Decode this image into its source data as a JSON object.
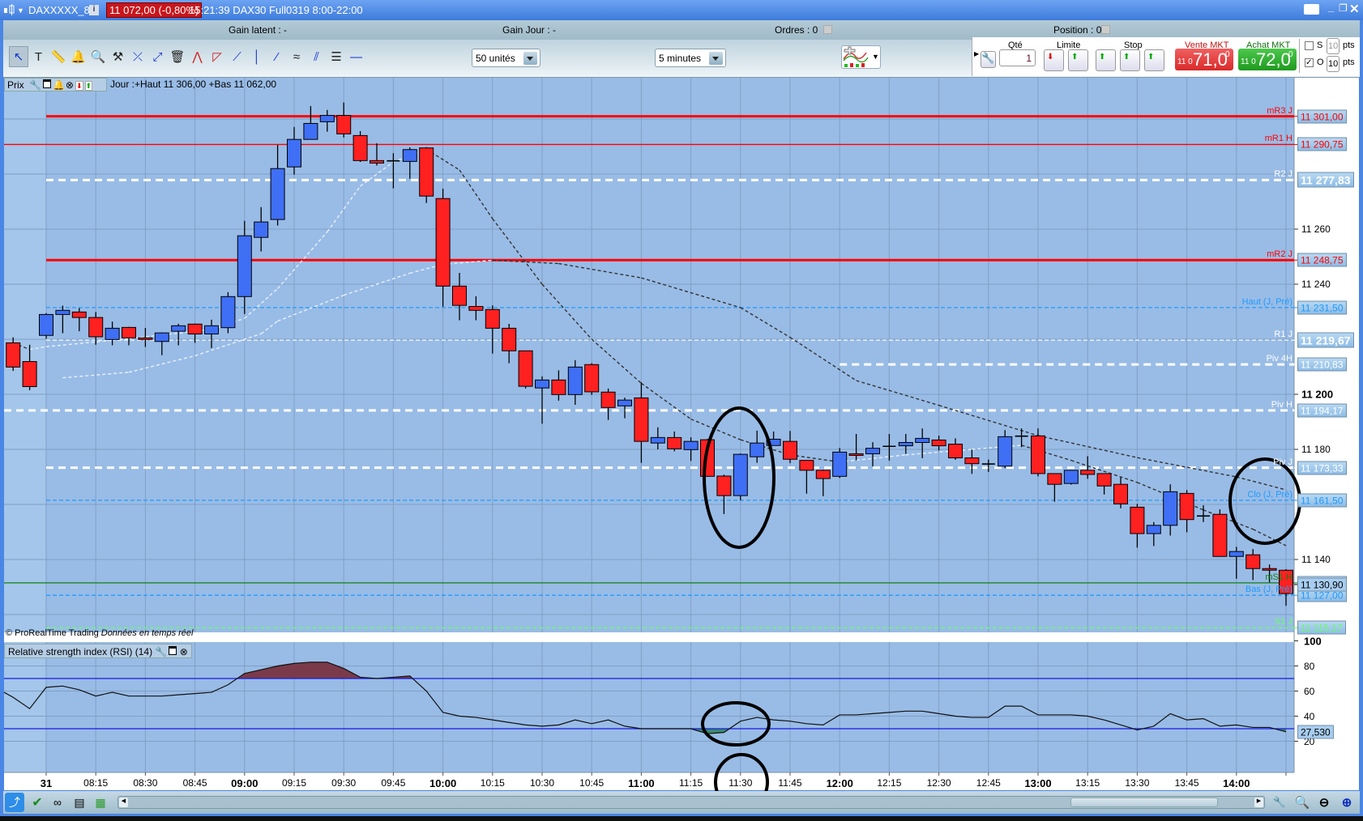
{
  "window": {
    "symbol": "DAXXXXX_8",
    "price_badge": "11 072,00 (-0,80%)",
    "info": "15:21:39 DAX30 Full0319 8:00-22:00"
  },
  "infobar": {
    "gain_latent": "Gain latent : -",
    "gain_jour": "Gain Jour : -",
    "ordres": "Ordres : 0",
    "position": "Position : 0"
  },
  "toolbar": {
    "tools": [
      "pointer-icon",
      "text-icon",
      "ruler-icon",
      "alert-bell-icon",
      "zoom-magnifier-icon",
      "tools-icon",
      "cross-line-icon",
      "point-line-icon",
      "trash-icon",
      "channel-icon",
      "triangle-icon",
      "trendline-icon",
      "vertical-line-icon",
      "segment-icon",
      "regression-icon",
      "parallel-lines-icon",
      "fibonacci-icon",
      "horizontal-line-icon"
    ],
    "units_select": "50 unités",
    "timeframe_select": "5 minutes"
  },
  "order_panel": {
    "qty_label": "Qté",
    "qty_value": "1",
    "limit_label": "Limite",
    "stop_label": "Stop",
    "sell_label": "Vente MKT",
    "sell_prefix": "11 0",
    "sell_big": "71,0",
    "sell_sup": "0",
    "buy_label": "Achat MKT",
    "buy_prefix": "11 0",
    "buy_big": "72,0",
    "buy_sup": "0",
    "s_label": "S",
    "s_checked": false,
    "s_pts": "10",
    "o_label": "O",
    "o_checked": true,
    "o_pts": "10",
    "pts_label": "pts",
    "sell_color": "#e23b3b",
    "buy_color": "#2ea82e"
  },
  "chart_header": {
    "prix": "Prix",
    "jour": "Jour :+Haut 11 306,00 +Bas 11 062,00"
  },
  "footer": {
    "copyright": "© ProRealTime Trading",
    "realtime": "Données en temps réel"
  },
  "rsi_header": "Relative strength index (RSI) (14)",
  "chart_data": {
    "type": "candlestick",
    "timeframe": "5 minutes",
    "colors": {
      "up": "#3f6ff5",
      "down": "#ff2020",
      "background": "#99bce6",
      "grid": "#7f9fc6"
    },
    "candles_fields": [
      "time",
      "open",
      "high",
      "low",
      "close"
    ],
    "candles": [
      [
        "07:50",
        11218.7,
        11220.7,
        11208.5,
        11209.9
      ],
      [
        "07:55",
        11211.9,
        11218.0,
        11201.5,
        11202.8
      ],
      [
        "08:00",
        11221.4,
        11229.5,
        11220.2,
        11229.0
      ],
      [
        "08:05",
        11229.0,
        11232.2,
        11222.2,
        11230.5
      ],
      [
        "08:10",
        11229.9,
        11231.3,
        11222.9,
        11227.9
      ],
      [
        "08:15",
        11227.9,
        11229.9,
        11218.0,
        11220.9
      ],
      [
        "08:20",
        11219.9,
        11226.4,
        11217.8,
        11224.0
      ],
      [
        "08:25",
        11224.3,
        11224.5,
        11217.8,
        11220.5
      ],
      [
        "08:30",
        11220.5,
        11224.1,
        11217.2,
        11219.9
      ],
      [
        "08:35",
        11219.2,
        11222.5,
        11214.2,
        11222.3
      ],
      [
        "08:40",
        11222.9,
        11225.6,
        11217.8,
        11224.9
      ],
      [
        "08:45",
        11225.5,
        11225.7,
        11218.7,
        11221.9
      ],
      [
        "08:50",
        11221.9,
        11227.1,
        11216.8,
        11224.9
      ],
      [
        "08:55",
        11224.2,
        11237.1,
        11222.2,
        11235.5
      ],
      [
        "09:00",
        11235.5,
        11263.0,
        11229.2,
        11257.6
      ],
      [
        "09:05",
        11257.0,
        11268.0,
        11251.9,
        11262.6
      ],
      [
        "09:10",
        11263.5,
        11290.6,
        11261.3,
        11282.0
      ],
      [
        "09:15",
        11282.6,
        11297.1,
        11279.8,
        11292.6
      ],
      [
        "09:20",
        11292.6,
        11304.7,
        11292.6,
        11298.4
      ],
      [
        "09:25",
        11299.0,
        11303.3,
        11295.4,
        11301.3
      ],
      [
        "09:30",
        11301.3,
        11306.0,
        11293.3,
        11294.6
      ],
      [
        "09:35",
        11294.0,
        11295.6,
        11284.4,
        11284.9
      ],
      [
        "09:40",
        11284.9,
        11291.2,
        11283.1,
        11284.0
      ],
      [
        "09:45",
        11284.8,
        11287.6,
        11274.8,
        11284.6
      ],
      [
        "09:50",
        11284.6,
        11289.7,
        11278.3,
        11288.9
      ],
      [
        "09:55",
        11289.5,
        11289.8,
        11269.5,
        11272.0
      ],
      [
        "10:00",
        11271.1,
        11274.7,
        11231.8,
        11239.3
      ],
      [
        "10:05",
        11239.3,
        11244.1,
        11226.9,
        11232.3
      ],
      [
        "10:10",
        11231.9,
        11235.6,
        11226.9,
        11230.5
      ],
      [
        "10:15",
        11230.8,
        11232.3,
        11214.8,
        11224.0
      ],
      [
        "10:20",
        11224.0,
        11225.6,
        11211.3,
        11215.8
      ],
      [
        "10:25",
        11215.8,
        11215.8,
        11202.1,
        11202.9
      ],
      [
        "10:30",
        11202.3,
        11206.5,
        11189.3,
        11205.2
      ],
      [
        "10:35",
        11205.2,
        11208.7,
        11197.7,
        11199.9
      ],
      [
        "10:40",
        11199.9,
        11212.4,
        11196.2,
        11209.9
      ],
      [
        "10:45",
        11210.8,
        11211.3,
        11199.8,
        11200.9
      ],
      [
        "10:50",
        11200.8,
        11202.1,
        11190.7,
        11195.2
      ],
      [
        "10:55",
        11195.8,
        11198.8,
        11191.3,
        11197.9
      ],
      [
        "11:00",
        11198.7,
        11204.3,
        11175.1,
        11182.9
      ],
      [
        "11:05",
        11182.3,
        11188.0,
        11180.0,
        11184.3
      ],
      [
        "11:10",
        11184.3,
        11186.5,
        11179.3,
        11180.2
      ],
      [
        "11:15",
        11179.9,
        11184.4,
        11175.8,
        11182.9
      ],
      [
        "11:20",
        11183.5,
        11183.8,
        11170.0,
        11170.2
      ],
      [
        "11:25",
        11170.3,
        11170.8,
        11156.5,
        11163.2
      ],
      [
        "11:30",
        11163.2,
        11178.5,
        11161.5,
        11178.2
      ],
      [
        "11:35",
        11177.3,
        11186.8,
        11175.1,
        11182.3
      ],
      [
        "11:40",
        11181.4,
        11186.5,
        11181.4,
        11183.7
      ],
      [
        "11:45",
        11182.9,
        11186.7,
        11175.0,
        11176.4
      ],
      [
        "11:50",
        11176.0,
        11176.0,
        11163.9,
        11172.4
      ],
      [
        "11:55",
        11172.4,
        11172.6,
        11163.0,
        11169.4
      ],
      [
        "12:00",
        11170.2,
        11180.5,
        11169.6,
        11179.0
      ],
      [
        "12:05",
        11178.4,
        11185.6,
        11176.0,
        11177.8
      ],
      [
        "12:10",
        11178.4,
        11182.6,
        11173.8,
        11180.4
      ],
      [
        "12:15",
        11181.1,
        11185.6,
        11175.9,
        11181.1
      ],
      [
        "12:20",
        11181.3,
        11185.6,
        11178.4,
        11182.5
      ],
      [
        "12:25",
        11182.5,
        11187.6,
        11176.8,
        11184.0
      ],
      [
        "12:30",
        11183.4,
        11185.0,
        11179.6,
        11181.3
      ],
      [
        "12:35",
        11181.9,
        11184.0,
        11176.2,
        11176.9
      ],
      [
        "12:40",
        11176.9,
        11179.9,
        11171.1,
        11174.8
      ],
      [
        "12:45",
        11174.7,
        11176.3,
        11171.8,
        11174.7
      ],
      [
        "12:50",
        11173.9,
        11187.0,
        11173.2,
        11184.6
      ],
      [
        "12:55",
        11184.8,
        11187.6,
        11180.8,
        11184.8
      ],
      [
        "13:00",
        11184.9,
        11187.6,
        11170.2,
        11171.2
      ],
      [
        "13:05",
        11171.2,
        11171.2,
        11161.0,
        11167.3
      ],
      [
        "13:10",
        11167.6,
        11172.4,
        11167.2,
        11172.4
      ],
      [
        "13:15",
        11172.4,
        11177.5,
        11169.3,
        11170.9
      ],
      [
        "13:20",
        11171.2,
        11171.2,
        11163.6,
        11166.7
      ],
      [
        "13:25",
        11167.3,
        11169.8,
        11158.6,
        11160.2
      ],
      [
        "13:30",
        11159.0,
        11160.2,
        11144.3,
        11149.4
      ],
      [
        "13:35",
        11149.4,
        11153.6,
        11144.9,
        11152.4
      ],
      [
        "13:40",
        11152.4,
        11167.3,
        11148.7,
        11164.6
      ],
      [
        "13:45",
        11164.0,
        11165.2,
        11149.9,
        11154.5
      ],
      [
        "13:50",
        11155.8,
        11159.7,
        11153.6,
        11155.8
      ],
      [
        "13:55",
        11156.4,
        11158.2,
        11141.0,
        11141.1
      ],
      [
        "14:00",
        11141.1,
        11144.6,
        11133.0,
        11142.9
      ],
      [
        "14:05",
        11141.7,
        11143.8,
        11132.5,
        11136.7
      ],
      [
        "14:10",
        11136.7,
        11138.2,
        11131.7,
        11136.1
      ],
      [
        "14:15",
        11136.1,
        11136.5,
        11123.2,
        11127.6
      ]
    ],
    "moving_averages": [
      {
        "rising_color": "#e8f0ff",
        "falling_color": "#333333",
        "points": [
          [
            "07:50",
            11218.7
          ],
          [
            "07:55",
            11216.3
          ],
          [
            "08:00",
            11217.3
          ],
          [
            "08:25",
            11220.2
          ],
          [
            "08:50",
            11223.6
          ],
          [
            "09:00",
            11227.6
          ],
          [
            "09:10",
            11238.4
          ],
          [
            "09:25",
            11259.0
          ],
          [
            "09:35",
            11275.6
          ],
          [
            "09:45",
            11284.4
          ],
          [
            "09:55",
            11289.0
          ],
          [
            "10:05",
            11281.5
          ],
          [
            "10:15",
            11263.8
          ],
          [
            "10:30",
            11240.0
          ],
          [
            "10:45",
            11220.0
          ],
          [
            "11:00",
            11204.0
          ],
          [
            "11:15",
            11191.0
          ],
          [
            "11:30",
            11183.5
          ],
          [
            "11:45",
            11178.0
          ],
          [
            "12:00",
            11175.4
          ],
          [
            "12:20",
            11178.0
          ],
          [
            "12:40",
            11180.0
          ],
          [
            "12:55",
            11181.5
          ],
          [
            "13:10",
            11176.0
          ],
          [
            "13:30",
            11168.0
          ],
          [
            "13:50",
            11158.0
          ],
          [
            "14:05",
            11151.0
          ],
          [
            "14:15",
            11145.0
          ]
        ]
      },
      {
        "rising_color": "#e8f0ff",
        "falling_color": "#333333",
        "points": [
          [
            "08:05",
            11206.0
          ],
          [
            "08:25",
            11208.0
          ],
          [
            "08:45",
            11214.0
          ],
          [
            "09:05",
            11222.0
          ],
          [
            "09:10",
            11226.6
          ],
          [
            "09:30",
            11236.0
          ],
          [
            "09:50",
            11244.0
          ],
          [
            "10:00",
            11247.2
          ],
          [
            "10:15",
            11248.7
          ],
          [
            "10:35",
            11247.5
          ],
          [
            "11:00",
            11242.3
          ],
          [
            "11:30",
            11231.5
          ],
          [
            "11:45",
            11220.7
          ],
          [
            "12:05",
            11205.0
          ],
          [
            "12:30",
            11196.0
          ],
          [
            "13:00",
            11185.0
          ],
          [
            "13:30",
            11177.0
          ],
          [
            "14:00",
            11170.0
          ],
          [
            "14:15",
            11165.3
          ]
        ]
      }
    ],
    "levels": [
      {
        "name": "mR3 J",
        "value": 11301.0,
        "label": "11 301,00",
        "color": "#ff0000",
        "style": "solid-thick",
        "from": "08:00"
      },
      {
        "name": "mR1 H",
        "value": 11290.75,
        "label": "11 290,75",
        "color": "#ff0000",
        "style": "solid",
        "from": null
      },
      {
        "name": "R2 J",
        "value": 11277.83,
        "label": "11 277,83",
        "color": "#ffffff",
        "style": "dashed-thick",
        "from": "08:00",
        "big": true
      },
      {
        "name": "mR2 J",
        "value": 11248.75,
        "label": "11 248,75",
        "color": "#ff0000",
        "style": "solid-thick",
        "from": "08:00"
      },
      {
        "name": "Haut (J, Pré)",
        "value": 11231.5,
        "label": "11 231,50",
        "color": "#1e9bff",
        "style": "dashed",
        "from": "08:00"
      },
      {
        "name": "R1 J",
        "value": 11219.67,
        "label": "11 219,67",
        "color": "#ffffff",
        "style": "dashed",
        "from": "08:00",
        "big": true
      },
      {
        "name": "Piv 4H",
        "value": 11210.83,
        "label": "11 210,83",
        "color": "#ffffff",
        "style": "dashed-thick",
        "from": "12:00"
      },
      {
        "name": "Piv H",
        "value": 11194.17,
        "label": "11 194,17",
        "color": "#ffffff",
        "style": "dashed-thick",
        "from": null
      },
      {
        "name": "Piv J",
        "value": 11173.33,
        "label": "11 173,33",
        "color": "#ffffff",
        "style": "dashed-thick",
        "from": "08:00"
      },
      {
        "name": "Clo (J, Pré)",
        "value": 11161.5,
        "label": "11 161,50",
        "color": "#1e9bff",
        "style": "dashed",
        "from": "08:00"
      },
      {
        "name": "mS1 H",
        "value": 11131.5,
        "label": "11 131,50",
        "color": "#108010",
        "style": "solid",
        "from": null
      },
      {
        "name": "Bas (J, Pré)",
        "value": 11127.0,
        "label": "11 127,00",
        "color": "#1e9bff",
        "style": "dashed",
        "from": "08:00"
      },
      {
        "name": "S1 J",
        "value": 11115.17,
        "label": "11 115,17",
        "color": "#66ff66",
        "style": "dashed",
        "from": "08:00"
      }
    ],
    "last_price": {
      "value": 11130.9,
      "label": "11 130,90"
    },
    "y_ticks": [
      {
        "value": 11260,
        "label": "11 260"
      },
      {
        "value": 11240,
        "label": "11 240"
      },
      {
        "value": 11200,
        "label": "11 200",
        "major": true
      },
      {
        "value": 11180,
        "label": "11 180"
      },
      {
        "value": 11140,
        "label": "11 140"
      }
    ],
    "x_ticks": [
      {
        "time": "08:00",
        "label": "31",
        "major": true
      },
      {
        "time": "08:15",
        "label": "08:15"
      },
      {
        "time": "08:30",
        "label": "08:30"
      },
      {
        "time": "08:45",
        "label": "08:45"
      },
      {
        "time": "09:00",
        "label": "09:00",
        "major": true
      },
      {
        "time": "09:15",
        "label": "09:15"
      },
      {
        "time": "09:30",
        "label": "09:30"
      },
      {
        "time": "09:45",
        "label": "09:45"
      },
      {
        "time": "10:00",
        "label": "10:00",
        "major": true
      },
      {
        "time": "10:15",
        "label": "10:15"
      },
      {
        "time": "10:30",
        "label": "10:30"
      },
      {
        "time": "10:45",
        "label": "10:45"
      },
      {
        "time": "11:00",
        "label": "11:00",
        "major": true
      },
      {
        "time": "11:15",
        "label": "11:15"
      },
      {
        "time": "11:30",
        "label": "11:30"
      },
      {
        "time": "11:45",
        "label": "11:45"
      },
      {
        "time": "12:00",
        "label": "12:00",
        "major": true
      },
      {
        "time": "12:15",
        "label": "12:15"
      },
      {
        "time": "12:30",
        "label": "12:30"
      },
      {
        "time": "12:45",
        "label": "12:45"
      },
      {
        "time": "13:00",
        "label": "13:00",
        "major": true
      },
      {
        "time": "13:15",
        "label": "13:15"
      },
      {
        "time": "13:30",
        "label": "13:30"
      },
      {
        "time": "13:45",
        "label": "13:45"
      },
      {
        "time": "14:00",
        "label": "14:00",
        "major": true
      }
    ],
    "rsi": {
      "period": 14,
      "overbought": 70,
      "oversold": 30,
      "ylim": [
        0,
        100
      ],
      "ticks": [
        {
          "value": 100,
          "label": "100",
          "major": true
        },
        {
          "value": 80,
          "label": "80"
        },
        {
          "value": 60,
          "label": "60"
        },
        {
          "value": 40,
          "label": "40"
        },
        {
          "value": 20,
          "label": "20"
        }
      ],
      "last_label": "27,530",
      "overbought_fill": "#7a3a4a",
      "oversold_fill": "#3a8a6a",
      "values": [
        55,
        46,
        63,
        64,
        61,
        56,
        59,
        56,
        56,
        56,
        57,
        58,
        59,
        65,
        74,
        77,
        80,
        82,
        83,
        83,
        78,
        71,
        70,
        71,
        72,
        60,
        43,
        40,
        39,
        37,
        35,
        33,
        32,
        33,
        37,
        34,
        37,
        32,
        30,
        30,
        30,
        30,
        26,
        27,
        36,
        39,
        37,
        36,
        34,
        33,
        41,
        41,
        42,
        43,
        44,
        44,
        42,
        40,
        39,
        39,
        48,
        48,
        41,
        41,
        41,
        40,
        37,
        33,
        29,
        32,
        42,
        37,
        38,
        32,
        33,
        31,
        31,
        27.53
      ]
    }
  }
}
